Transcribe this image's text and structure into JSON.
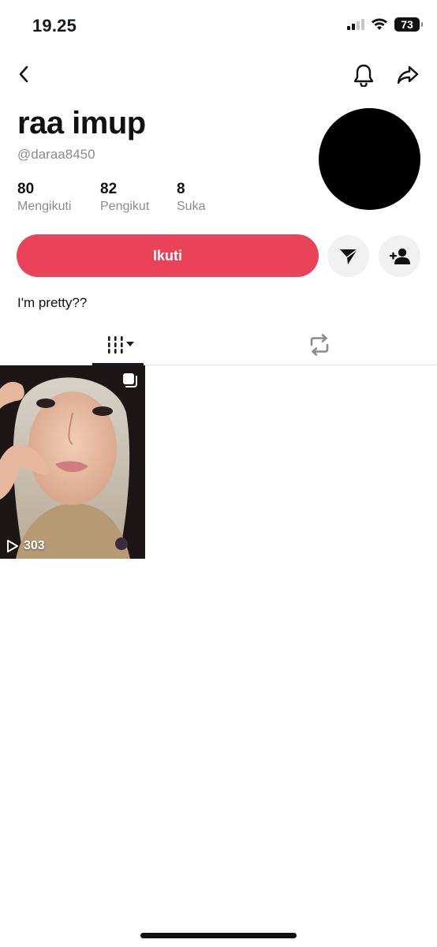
{
  "status_bar": {
    "time": "19.25",
    "battery": "73"
  },
  "profile": {
    "display_name": "raa imup",
    "username": "@daraa8450",
    "bio": "I'm pretty??"
  },
  "stats": [
    {
      "value": "80",
      "label": "Mengikuti"
    },
    {
      "value": "82",
      "label": "Pengikut"
    },
    {
      "value": "8",
      "label": "Suka"
    }
  ],
  "actions": {
    "follow_label": "Ikuti"
  },
  "videos": [
    {
      "views": "303",
      "type": "photo-carousel"
    }
  ],
  "colors": {
    "accent": "#ea4359",
    "muted_text": "#8a8b91"
  }
}
